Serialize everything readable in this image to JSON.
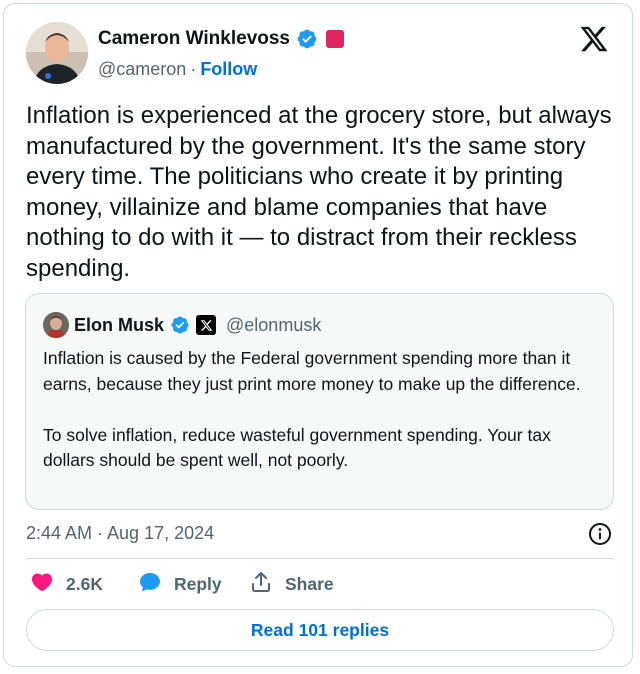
{
  "author": {
    "name": "Cameron Winklevoss",
    "handle": "@cameron",
    "separator": "·",
    "follow_label": "Follow"
  },
  "tweet": {
    "text": "Inflation is experienced at the grocery store, but always manufactured by the government. It's the same story every time. The politicians who create it by printing money, villainize and blame companies that have nothing to do with it — to distract from their reckless spending."
  },
  "quote": {
    "name": "Elon Musk",
    "handle": "@elonmusk",
    "text": "Inflation is caused by the Federal government spending more than it earns, because they just print more money to make up the difference.\n\nTo solve inflation, reduce wasteful government spending. Your tax dollars should be spent well, not poorly."
  },
  "meta": {
    "timestamp": "2:44 AM · Aug 17, 2024"
  },
  "actions": {
    "like_count": "2.6K",
    "reply_label": "Reply",
    "share_label": "Share",
    "read_replies_label": "Read 101 replies"
  },
  "icons": {
    "verified": "verified-badge-icon",
    "x_logo": "x-logo-icon",
    "heart": "heart-icon",
    "reply": "reply-bubble-icon",
    "share": "share-icon",
    "info": "info-icon"
  },
  "colors": {
    "verified_blue": "#1d9bf0",
    "follow_blue": "#006fd6",
    "like_pink": "#f91880",
    "badge_pink": "#e0245e",
    "reply_blue": "#1d9bf0",
    "muted_text": "#536471",
    "border": "#cfd9de"
  }
}
